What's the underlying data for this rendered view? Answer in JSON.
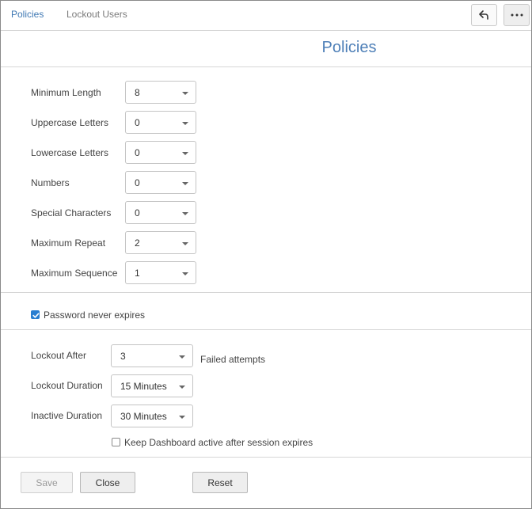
{
  "tabs": [
    {
      "label": "Policies",
      "active": true
    },
    {
      "label": "Lockout Users",
      "active": false
    }
  ],
  "toolbar": {
    "undo_icon": "undo-arrow-icon",
    "more_icon": "ellipsis-icon"
  },
  "page_title": "Policies",
  "password_fields": [
    {
      "label": "Minimum Length",
      "value": "8"
    },
    {
      "label": "Uppercase Letters",
      "value": "0"
    },
    {
      "label": "Lowercase Letters",
      "value": "0"
    },
    {
      "label": "Numbers",
      "value": "0"
    },
    {
      "label": "Special Characters",
      "value": "0"
    },
    {
      "label": "Maximum Repeat",
      "value": "2"
    },
    {
      "label": "Maximum Sequence",
      "value": "1"
    }
  ],
  "never_expires": {
    "label": "Password never expires",
    "checked": true
  },
  "lockout": {
    "after": {
      "label": "Lockout After",
      "value": "3",
      "suffix": "Failed attempts"
    },
    "duration": {
      "label": "Lockout Duration",
      "value": "15 Minutes"
    },
    "inactive": {
      "label": "Inactive Duration",
      "value": "30 Minutes"
    },
    "keep_active": {
      "label": "Keep Dashboard active after session expires",
      "checked": false
    }
  },
  "footer": {
    "save": "Save",
    "close": "Close",
    "reset": "Reset"
  },
  "colors": {
    "accent": "#4f80b8",
    "tab_active": "#3f78b3",
    "checkbox": "#2a7fd1"
  }
}
